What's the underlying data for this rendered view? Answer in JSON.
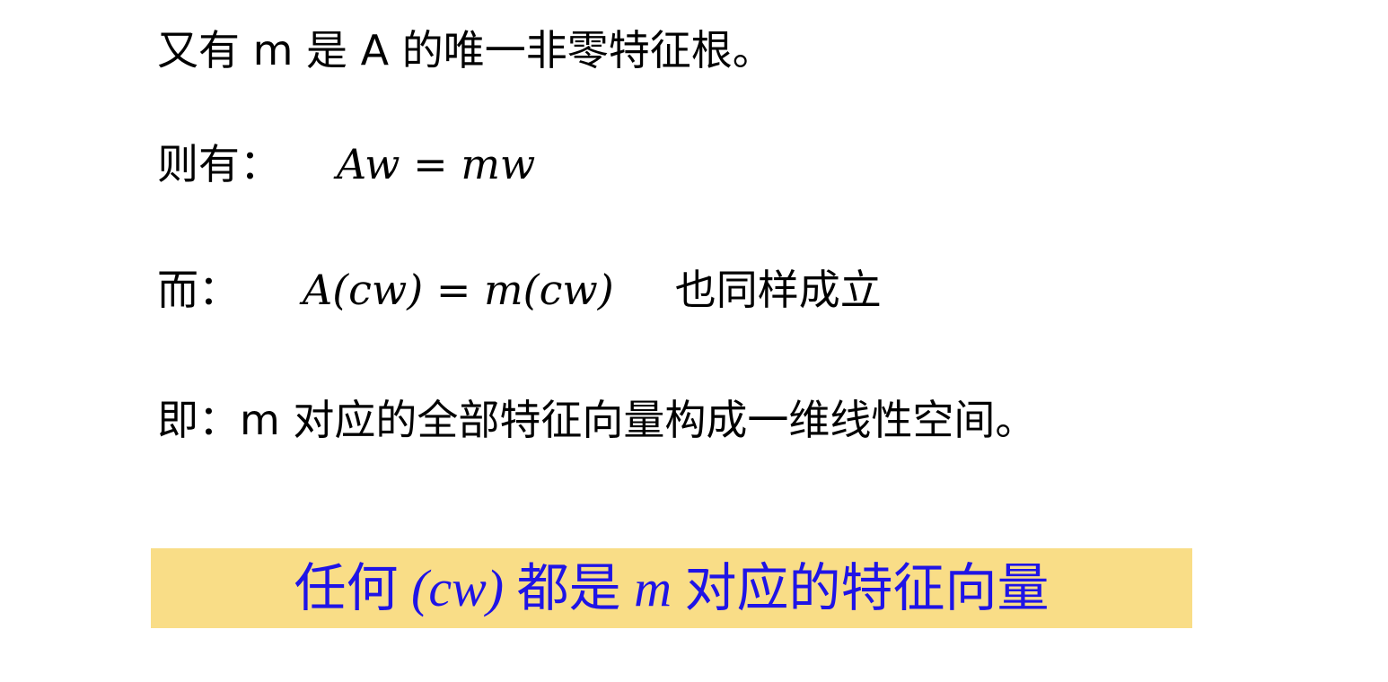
{
  "line1": {
    "text": "又有 m 是 A 的唯一非零特征根。"
  },
  "line2": {
    "label": "则有：",
    "equation": "Aw = mw"
  },
  "line3": {
    "label": "而：",
    "equation": "A(cw) = m(cw)",
    "suffix": "也同样成立"
  },
  "line4": {
    "text": "即：m 对应的全部特征向量构成一维线性空间。"
  },
  "highlight": {
    "prefix": "任何 ",
    "var1": "(cw)",
    "middle": " 都是 ",
    "var2": "m",
    "suffix": " 对应的特征向量",
    "background_color": "#f9dd87",
    "text_color": "#1f14e6"
  }
}
